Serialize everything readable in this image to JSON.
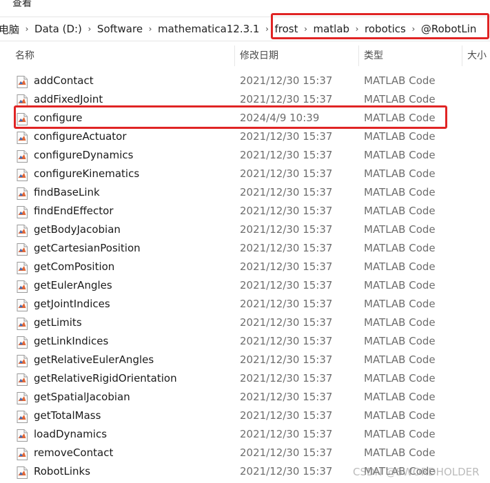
{
  "menubar": {
    "view_label": "查看"
  },
  "breadcrumb": {
    "items": [
      "电脑",
      "Data (D:)",
      "Software",
      "mathematica12.3.1",
      "frost",
      "matlab",
      "robotics",
      "@RobotLin"
    ]
  },
  "columns": {
    "name": "名称",
    "modified": "修改日期",
    "type": "类型",
    "size": "大小"
  },
  "files": [
    {
      "name": "addContact",
      "modified": "2021/12/30 15:37",
      "type": "MATLAB Code"
    },
    {
      "name": "addFixedJoint",
      "modified": "2021/12/30 15:37",
      "type": "MATLAB Code"
    },
    {
      "name": "configure",
      "modified": "2024/4/9 10:39",
      "type": "MATLAB Code"
    },
    {
      "name": "configureActuator",
      "modified": "2021/12/30 15:37",
      "type": "MATLAB Code"
    },
    {
      "name": "configureDynamics",
      "modified": "2021/12/30 15:37",
      "type": "MATLAB Code"
    },
    {
      "name": "configureKinematics",
      "modified": "2021/12/30 15:37",
      "type": "MATLAB Code"
    },
    {
      "name": "findBaseLink",
      "modified": "2021/12/30 15:37",
      "type": "MATLAB Code"
    },
    {
      "name": "findEndEffector",
      "modified": "2021/12/30 15:37",
      "type": "MATLAB Code"
    },
    {
      "name": "getBodyJacobian",
      "modified": "2021/12/30 15:37",
      "type": "MATLAB Code"
    },
    {
      "name": "getCartesianPosition",
      "modified": "2021/12/30 15:37",
      "type": "MATLAB Code"
    },
    {
      "name": "getComPosition",
      "modified": "2021/12/30 15:37",
      "type": "MATLAB Code"
    },
    {
      "name": "getEulerAngles",
      "modified": "2021/12/30 15:37",
      "type": "MATLAB Code"
    },
    {
      "name": "getJointIndices",
      "modified": "2021/12/30 15:37",
      "type": "MATLAB Code"
    },
    {
      "name": "getLimits",
      "modified": "2021/12/30 15:37",
      "type": "MATLAB Code"
    },
    {
      "name": "getLinkIndices",
      "modified": "2021/12/30 15:37",
      "type": "MATLAB Code"
    },
    {
      "name": "getRelativeEulerAngles",
      "modified": "2021/12/30 15:37",
      "type": "MATLAB Code"
    },
    {
      "name": "getRelativeRigidOrientation",
      "modified": "2021/12/30 15:37",
      "type": "MATLAB Code"
    },
    {
      "name": "getSpatialJacobian",
      "modified": "2021/12/30 15:37",
      "type": "MATLAB Code"
    },
    {
      "name": "getTotalMass",
      "modified": "2021/12/30 15:37",
      "type": "MATLAB Code"
    },
    {
      "name": "loadDynamics",
      "modified": "2021/12/30 15:37",
      "type": "MATLAB Code"
    },
    {
      "name": "removeContact",
      "modified": "2021/12/30 15:37",
      "type": "MATLAB Code"
    },
    {
      "name": "RobotLinks",
      "modified": "2021/12/30 15:37",
      "type": "MATLAB Code"
    }
  ],
  "watermark": "CSDN @SWORDHOLDER",
  "colors": {
    "highlight": "#e02424",
    "matlab_orange": "#e16737"
  }
}
